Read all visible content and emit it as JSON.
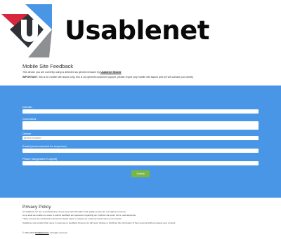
{
  "brand": {
    "name": "Usablenet",
    "logo_letter": "U",
    "colors": {
      "dark": "#2f3137",
      "blue": "#4a96e6",
      "red": "#d7263d",
      "gray": "#8d8f92"
    }
  },
  "intro": {
    "title": "Mobile Site Feedback",
    "line1_prefix": "This device you are currently using is detected as generic browser by",
    "line1_link": "Usablenet Mobile",
    "important_label": "IMPORTANT",
    "important_text": ": this is for mobile site issues only, this is not general customer support, please report only mobile site issues and we will contact you shortly."
  },
  "form": {
    "panel_color": "#4a96e6",
    "fields": [
      {
        "label": "Domain",
        "value": ""
      },
      {
        "label": "Comments",
        "value": ""
      },
      {
        "label": "Device",
        "value": "generic browser"
      },
      {
        "label": "Email (recommended for response)",
        "value": ""
      },
      {
        "label": "Phone (suggested if urgent)",
        "value": ""
      }
    ],
    "submit_label": "Submit",
    "submit_color": "#7ab644"
  },
  "privacy": {
    "title": "Privacy Policy",
    "lines": [
      "At Usablenet Inc. the security/privacy of your personal information and quality service are our highest concerns.",
      "As a result we enable our users to submit feedback and questions regarding our products via email, forms, and telephone.",
      "These surveys are conducted to determine better ways to support our customers and improve our process.",
      "Usablenet may contact their users in response to feedback however we will never divulge or distribute the information of their personal without request your consent."
    ]
  },
  "footer": {
    "copyright_prefix": "© 2004-2020",
    "copyright_brand": "Usablenet Inc",
    "copyright_suffix": ". All rights reserved."
  }
}
